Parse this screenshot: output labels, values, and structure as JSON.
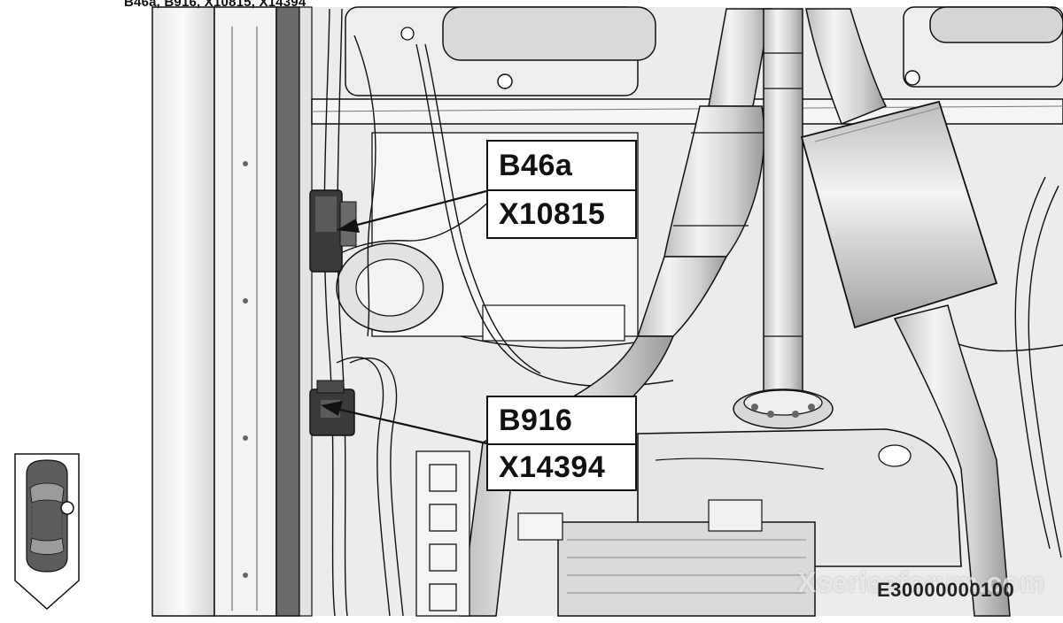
{
  "header": {
    "text": "B46a, B916, X10815, X14394"
  },
  "callouts": [
    {
      "component": "B46a",
      "connector": "X10815"
    },
    {
      "component": "B916",
      "connector": "X14394"
    }
  ],
  "footer": {
    "watermark": "Xseriesforum.com",
    "code": "E30000000100"
  },
  "icons": {
    "locator": "car-top-view-locator-icon"
  },
  "colors": {
    "line": "#111111",
    "fill_light": "#f2f2f2",
    "fill_mid": "#d4d4d4",
    "fill_dark": "#8a8a8a",
    "background": "#ffffff"
  }
}
